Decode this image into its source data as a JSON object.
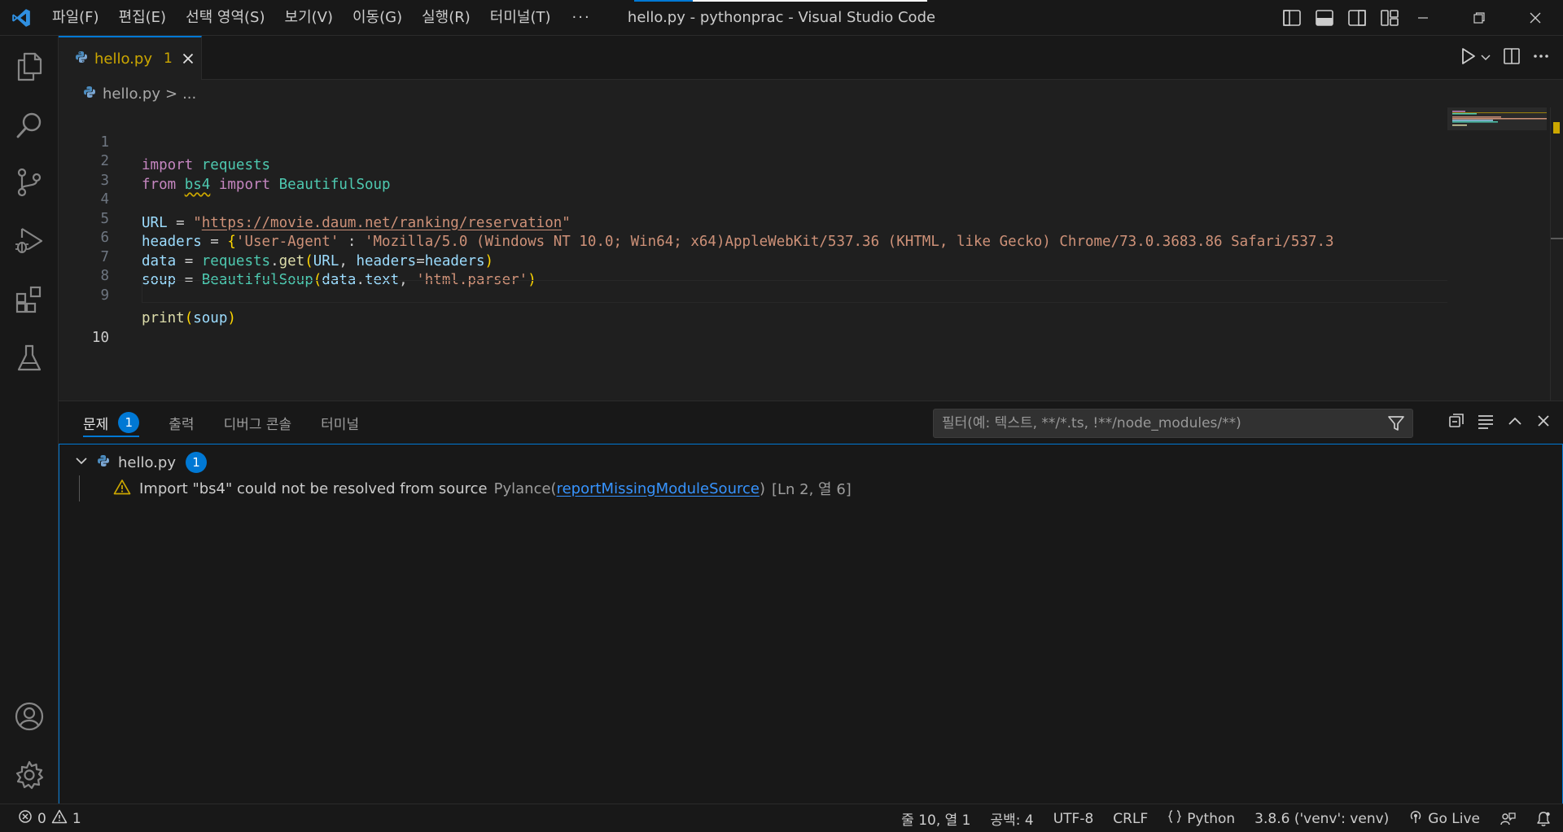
{
  "window": {
    "title": "hello.py - pythonprac - Visual Studio Code"
  },
  "menu": {
    "items": [
      "파일(F)",
      "편집(E)",
      "선택 영역(S)",
      "보기(V)",
      "이동(G)",
      "실행(R)",
      "터미널(T)"
    ],
    "more": "···"
  },
  "tab": {
    "label": "hello.py",
    "problem_count": "1"
  },
  "breadcrumb": {
    "file": "hello.py",
    "separator": ">",
    "rest": "..."
  },
  "code": {
    "line_numbers": [
      "1",
      "2",
      "3",
      "4",
      "5",
      "6",
      "7",
      "8",
      "9",
      "10"
    ],
    "l1_kw": "import",
    "l1_mod": "requests",
    "l2_from": "from",
    "l2_mod": "bs4",
    "l2_import": "import",
    "l2_cls": "BeautifulSoup",
    "l4_var": "URL",
    "l4_eq": " = ",
    "l4_q1": "\"",
    "l4_url": "https://movie.daum.net/ranking/reservation",
    "l4_q2": "\"",
    "l5_var": "headers",
    "l5_eq": " = ",
    "l5_brace": "{",
    "l5_key": "'User-Agent'",
    "l5_colon": " : ",
    "l5_val": "'Mozilla/5.0 (Windows NT 10.0; Win64; x64)AppleWebKit/537.36 (KHTML, like Gecko) Chrome/73.0.3683.86 Safari/537.3",
    "l6_var": "data",
    "l6_eq": " = ",
    "l6_mod": "requests",
    "l6_dot": ".",
    "l6_fn": "get",
    "l6_p1": "(",
    "l6_arg1": "URL",
    "l6_comma": ", ",
    "l6_kwarg": "headers",
    "l6_eq2": "=",
    "l6_arg2": "headers",
    "l6_p2": ")",
    "l7_var": "soup",
    "l7_eq": " = ",
    "l7_cls": "BeautifulSoup",
    "l7_p1": "(",
    "l7_arg1": "data",
    "l7_dot": ".",
    "l7_attr": "text",
    "l7_comma": ", ",
    "l7_str": "'html.parser'",
    "l7_p2": ")",
    "l9_fn": "print",
    "l9_p1": "(",
    "l9_arg": "soup",
    "l9_p2": ")"
  },
  "panel": {
    "tabs": [
      {
        "label": "문제",
        "badge": "1"
      },
      {
        "label": "출력"
      },
      {
        "label": "디버그 콘솔"
      },
      {
        "label": "터미널"
      }
    ],
    "filter_placeholder": "필터(예: 텍스트, **/*.ts, !**/node_modules/**)",
    "file": {
      "name": "hello.py",
      "count": "1"
    },
    "problem": {
      "message": "Import \"bs4\" could not be resolved from source",
      "source": "Pylance",
      "paren_open": "(",
      "code": "reportMissingModuleSource",
      "paren_close": ")",
      "location": "[Ln 2, 열 6]"
    }
  },
  "statusbar": {
    "errors": "0",
    "warnings": "1",
    "position": "줄 10, 열 1",
    "spaces": "공백: 4",
    "encoding": "UTF-8",
    "eol": "CRLF",
    "language": "Python",
    "interpreter": "3.8.6 ('venv': venv)",
    "golive": "Go Live"
  },
  "colors": {
    "accent": "#0078d4",
    "warning": "#cca700",
    "link": "#3794ff"
  }
}
